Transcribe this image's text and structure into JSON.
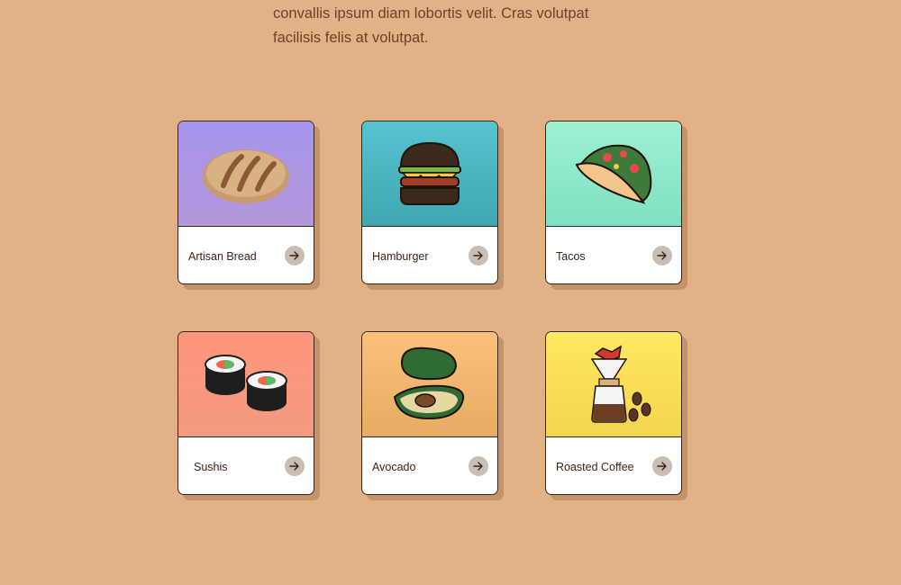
{
  "colors": {
    "background": "#e2b286",
    "text": "#6b4228"
  },
  "intro": {
    "line1": "convallis ipsum diam lobortis velit. Cras volutpat",
    "line2": "facilisis felis at volutpat."
  },
  "cards": [
    {
      "label": "Artisan Bread",
      "icon": "bread-icon",
      "bg_top": "#a795ee",
      "bg_bottom": "#b297d9"
    },
    {
      "label": "Hamburger",
      "icon": "hamburger-icon",
      "bg_top": "#57c4cf",
      "bg_bottom": "#3fa6b0"
    },
    {
      "label": "Tacos",
      "icon": "taco-icon",
      "bg_top": "#9ef0d3",
      "bg_bottom": "#7fe0c2"
    },
    {
      "label": "Sushis",
      "icon": "sushi-icon",
      "bg_top": "#ff957a",
      "bg_bottom": "#f29a80"
    },
    {
      "label": "Avocado",
      "icon": "avocado-icon",
      "bg_top": "#fbc17a",
      "bg_bottom": "#e7ab63"
    },
    {
      "label": "Roasted Coffee",
      "icon": "coffee-icon",
      "bg_top": "#ffe862",
      "bg_bottom": "#f3d54e"
    }
  ],
  "arrow_icon": "arrow-right-icon"
}
